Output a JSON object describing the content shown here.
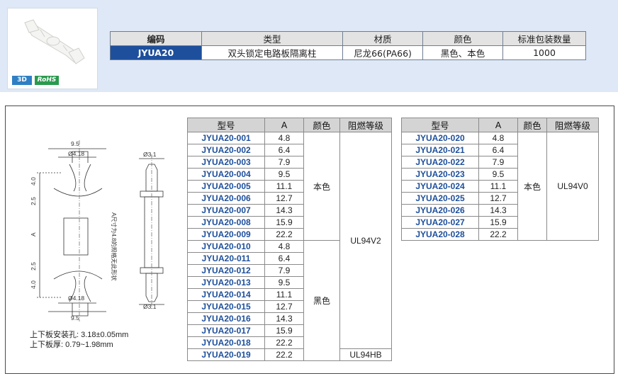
{
  "product": {
    "badge_3d": "3D",
    "badge_rohs": "RoHS"
  },
  "spec_table": {
    "headers": [
      "编码",
      "类型",
      "材质",
      "颜色",
      "标准包装数量"
    ],
    "values": [
      "JYUA20",
      "双头锁定电路板隔离柱",
      "尼龙66(PA66)",
      "黑色、本色",
      "1000"
    ]
  },
  "drawing": {
    "dims": {
      "top_width": "9.5",
      "top_dia": "Ø4.18",
      "side_dia_top": "Ø3.1",
      "h_top": "4.0",
      "gap_top": "2.5",
      "a_label": "A",
      "gap_bottom": "2.5",
      "h_bottom": "4.0",
      "bottom_dia": "Ø4.18",
      "bottom_width": "9.5",
      "side_dia_bottom": "Ø3.1",
      "side_note": "A尺寸为4.8的规格无此形状"
    },
    "notes": [
      "上下板安装孔: 3.18±0.05mm",
      "上下板厚: 0.79~1.98mm"
    ]
  },
  "model_table_1": {
    "headers": [
      "型号",
      "A",
      "颜色",
      "阻燃等级"
    ],
    "rows": [
      [
        "JYUA20-001",
        "4.8"
      ],
      [
        "JYUA20-002",
        "6.4"
      ],
      [
        "JYUA20-003",
        "7.9"
      ],
      [
        "JYUA20-004",
        "9.5"
      ],
      [
        "JYUA20-005",
        "11.1"
      ],
      [
        "JYUA20-006",
        "12.7"
      ],
      [
        "JYUA20-007",
        "14.3"
      ],
      [
        "JYUA20-008",
        "15.9"
      ],
      [
        "JYUA20-009",
        "22.2"
      ],
      [
        "JYUA20-010",
        "4.8"
      ],
      [
        "JYUA20-011",
        "6.4"
      ],
      [
        "JYUA20-012",
        "7.9"
      ],
      [
        "JYUA20-013",
        "9.5"
      ],
      [
        "JYUA20-014",
        "11.1"
      ],
      [
        "JYUA20-015",
        "12.7"
      ],
      [
        "JYUA20-016",
        "14.3"
      ],
      [
        "JYUA20-017",
        "15.9"
      ],
      [
        "JYUA20-018",
        "22.2"
      ],
      [
        "JYUA20-019",
        "22.2"
      ]
    ],
    "color_groups": [
      "本色",
      "黑色"
    ],
    "rating_groups": [
      "UL94V2",
      "UL94HB"
    ]
  },
  "model_table_2": {
    "headers": [
      "型号",
      "A",
      "颜色",
      "阻燃等级"
    ],
    "rows": [
      [
        "JYUA20-020",
        "4.8"
      ],
      [
        "JYUA20-021",
        "6.4"
      ],
      [
        "JYUA20-022",
        "7.9"
      ],
      [
        "JYUA20-023",
        "9.5"
      ],
      [
        "JYUA20-024",
        "11.1"
      ],
      [
        "JYUA20-025",
        "12.7"
      ],
      [
        "JYUA20-026",
        "14.3"
      ],
      [
        "JYUA20-027",
        "15.9"
      ],
      [
        "JYUA20-028",
        "22.2"
      ]
    ],
    "color": "本色",
    "rating": "UL94V0"
  }
}
